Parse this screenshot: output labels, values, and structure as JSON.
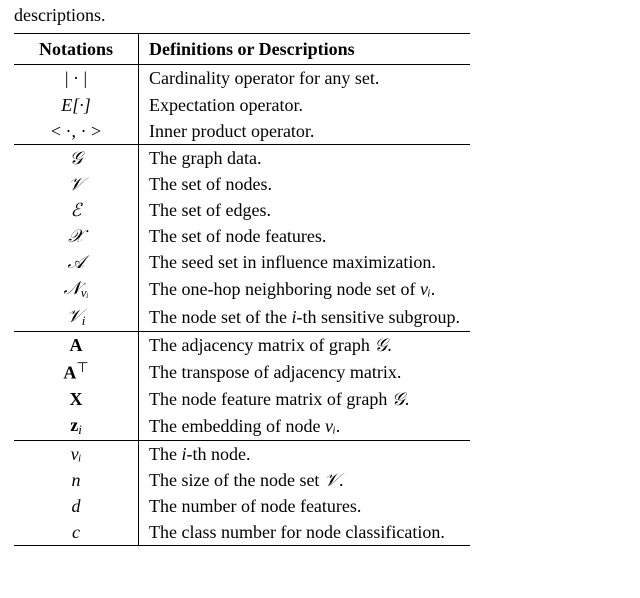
{
  "caption": "descriptions.",
  "headers": {
    "notations": "Notations",
    "definitions": "Definitions or Descriptions"
  },
  "g1": {
    "r0": {
      "n": "| · |",
      "d": "Cardinality operator for any set."
    },
    "r1": {
      "n": "E[·]",
      "d": "Expectation operator."
    },
    "r2": {
      "n": "< ·, · >",
      "d": "Inner product operator."
    }
  },
  "g2": {
    "r0": {
      "n": "𝒢",
      "d": "The graph data."
    },
    "r1": {
      "n": "𝒱",
      "d": "The set of nodes."
    },
    "r2": {
      "n": "ℰ",
      "d": "The set of edges."
    },
    "r3": {
      "n": "𝒳",
      "d": "The set of node features."
    },
    "r4": {
      "n": "𝒜",
      "d": "The seed set in influence maximization."
    },
    "r5": {
      "n": "𝒩",
      "sub": "vᵢ",
      "d_pre": "The one-hop neighboring node set of ",
      "d_math": "vᵢ",
      "d_post": "."
    },
    "r6": {
      "n": "𝒱",
      "sub": "i",
      "d_pre": "The node set of the ",
      "d_mid": "i",
      "d_post": "-th sensitive subgroup."
    }
  },
  "g3": {
    "r0": {
      "n": "A",
      "d_pre": "The adjacency matrix of graph ",
      "d_math": "𝒢",
      "d_post": "."
    },
    "r1": {
      "n": "A",
      "sup": "⊤",
      "d": "The transpose of adjacency matrix."
    },
    "r2": {
      "n": "X",
      "d_pre": "The node feature matrix of graph ",
      "d_math": "𝒢",
      "d_post": "."
    },
    "r3": {
      "n": "z",
      "sub": "i",
      "d_pre": "The embedding of node ",
      "d_math": "vᵢ",
      "d_post": "."
    }
  },
  "g4": {
    "r0": {
      "n": "vᵢ",
      "d_pre": "The ",
      "d_mid": "i",
      "d_post": "-th node."
    },
    "r1": {
      "n": "n",
      "d_pre": "The size of the node set ",
      "d_math": "𝒱",
      "d_post": "."
    },
    "r2": {
      "n": "d",
      "d": "The number of node features."
    },
    "r3": {
      "n": "c",
      "d": "The class number for node classification."
    }
  }
}
